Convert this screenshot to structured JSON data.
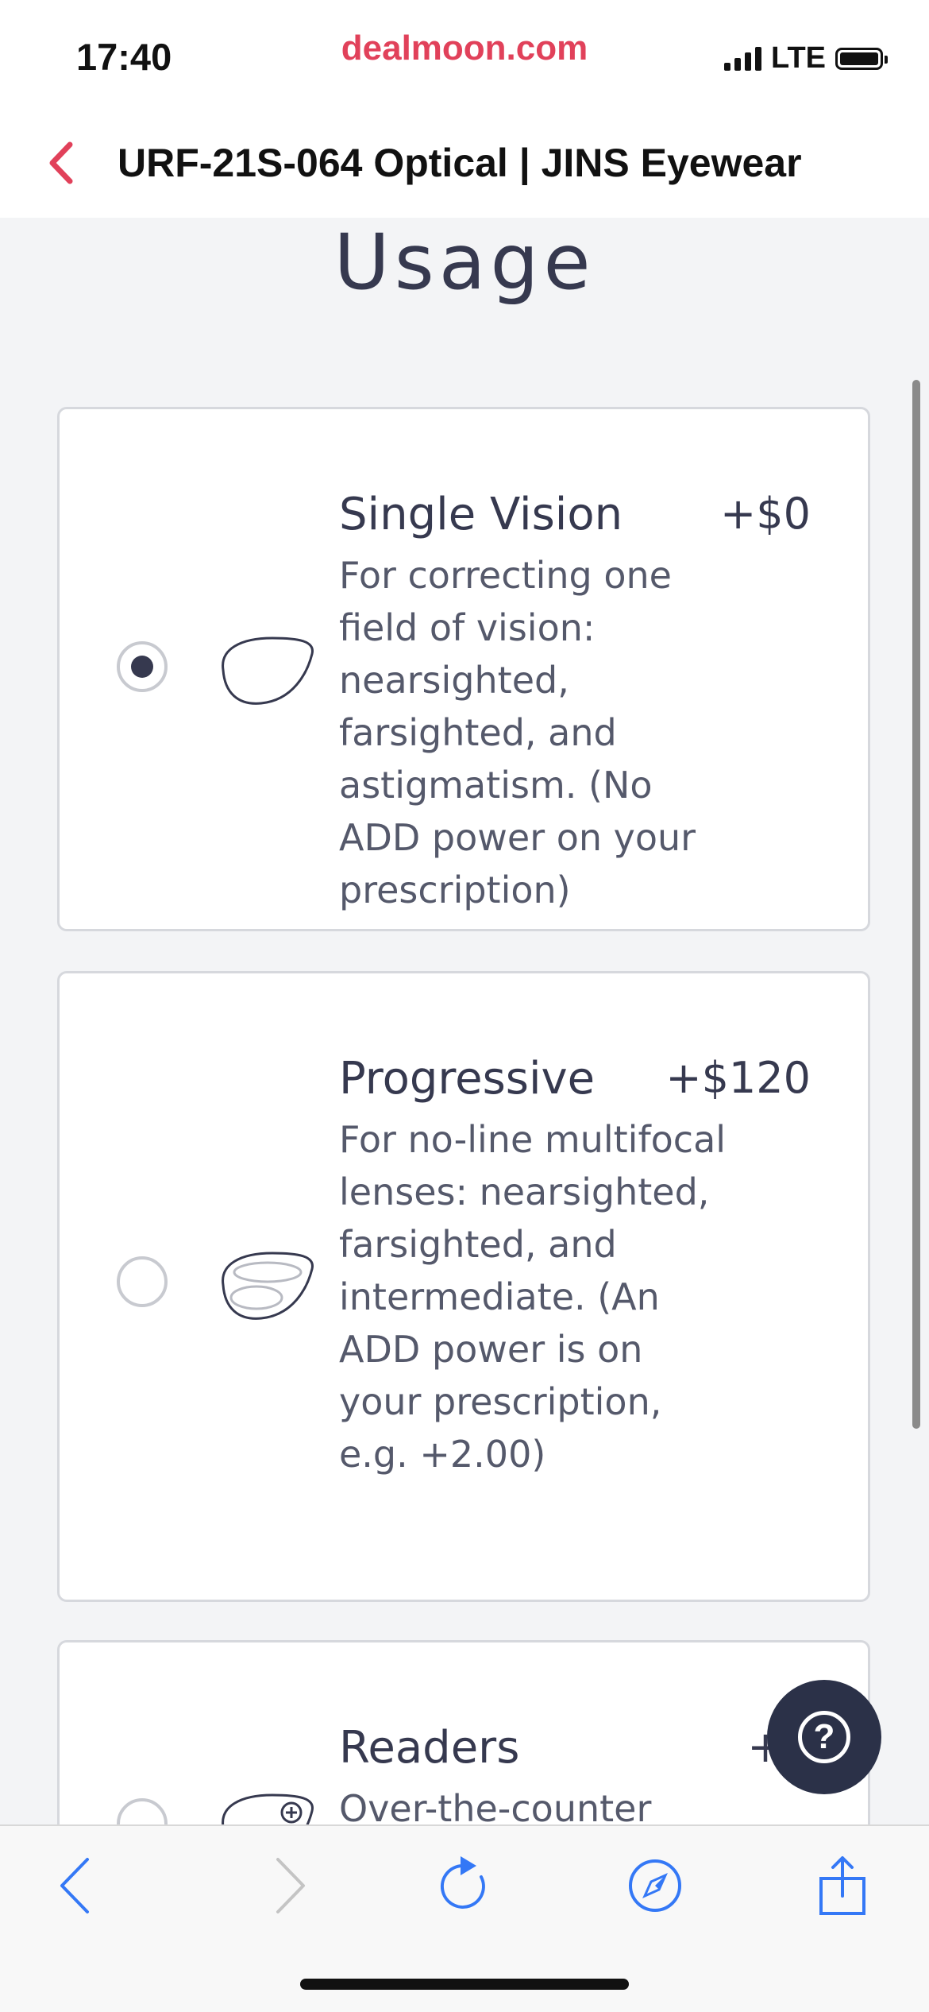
{
  "status": {
    "time": "17:40",
    "domain": "dealmoon.com",
    "network": "LTE"
  },
  "nav": {
    "title": "URF-21S-064 Optical | JINS Eyewear",
    "back_icon": "chevron-left-icon",
    "accent_color": "#e1415a"
  },
  "section": {
    "heading": "Usage"
  },
  "options": [
    {
      "name": "Single Vision",
      "price": "+$0",
      "description": "For correcting one field of vision: nearsighted, farsighted, and astigmatism. (No ADD power on your prescription)",
      "selected": true,
      "icon": "single-vision-lens-icon"
    },
    {
      "name": "Progressive",
      "price": "+$120",
      "description": "For no-line multifocal lenses: nearsighted, farsighted, and intermediate. (An ADD power is on your prescription, e.g. +2.00)",
      "selected": false,
      "icon": "progressive-lens-icon"
    },
    {
      "name": "Readers",
      "price": "+$",
      "description": "Over-the-counter",
      "selected": false,
      "icon": "readers-lens-icon"
    }
  ],
  "help": {
    "icon": "question-mark-icon"
  },
  "toolbar": {
    "icons": [
      "back-icon",
      "forward-icon",
      "reload-icon",
      "compass-icon",
      "share-icon"
    ]
  }
}
